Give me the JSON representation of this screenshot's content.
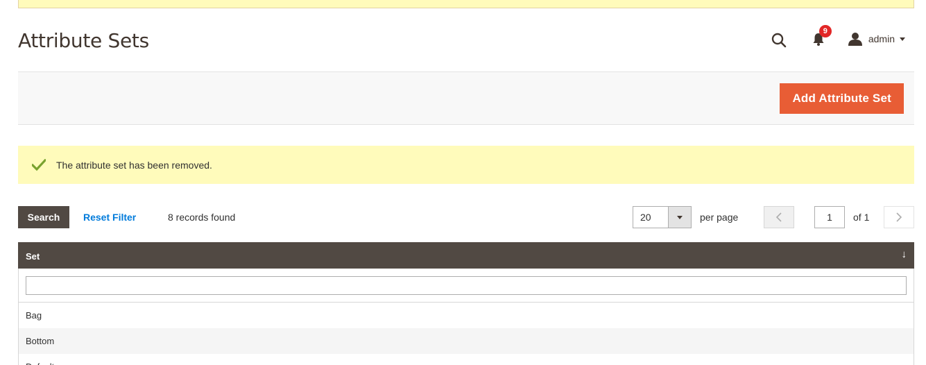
{
  "page": {
    "title": "Attribute Sets"
  },
  "header": {
    "search_icon": "search-icon",
    "notifications_icon": "bell-icon",
    "notifications_count": "9",
    "user_icon": "user-icon",
    "user_name": "admin"
  },
  "actions": {
    "add_button": "Add Attribute Set"
  },
  "message": {
    "icon": "checkmark-icon",
    "text": "The attribute set has been removed."
  },
  "toolbar": {
    "search_button": "Search",
    "reset_filter": "Reset Filter",
    "records_found": "8 records found",
    "per_page_value": "20",
    "per_page_label": "per page",
    "current_page": "1",
    "total_pages_label": "of 1"
  },
  "grid": {
    "column_header": "Set",
    "sort_indicator": "↓",
    "filter_value": "",
    "rows": [
      "Bag",
      "Bottom",
      "Default"
    ]
  },
  "colors": {
    "accent": "#e85d35",
    "dark": "#514943",
    "link": "#007bdb",
    "notice_bg": "#fffbbb",
    "success": "#79a22e",
    "badge": "#e22626"
  }
}
